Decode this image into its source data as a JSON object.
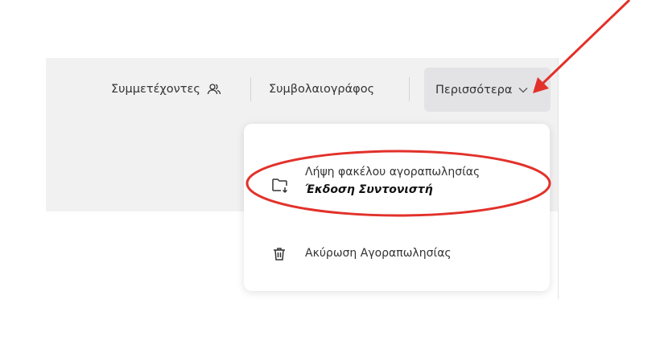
{
  "toolbar": {
    "participants_label": "Συμμετέχοντες",
    "notary_label": "Συμβολαιογράφος",
    "more_label": "Περισσότερα"
  },
  "menu": {
    "items": [
      {
        "label": "Λήψη φακέλου αγοραπωλησίας",
        "sublabel": "Έκδοση Συντονιστή",
        "icon": "folder-download-icon"
      },
      {
        "label": "Ακύρωση Αγοραπωλησίας",
        "icon": "trash-icon"
      }
    ]
  },
  "annotation": {
    "color": "#e2312a"
  }
}
